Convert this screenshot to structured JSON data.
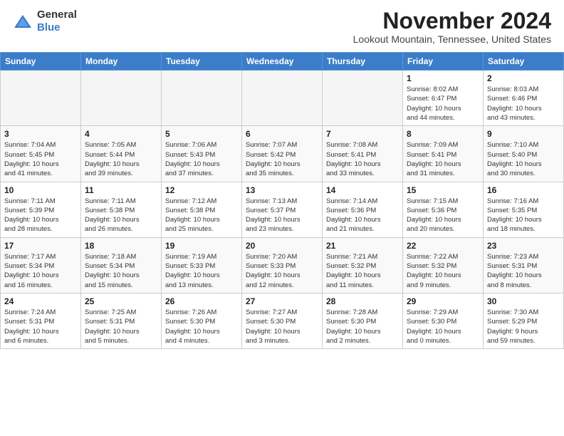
{
  "header": {
    "logo_general": "General",
    "logo_blue": "Blue",
    "month": "November 2024",
    "location": "Lookout Mountain, Tennessee, United States"
  },
  "weekdays": [
    "Sunday",
    "Monday",
    "Tuesday",
    "Wednesday",
    "Thursday",
    "Friday",
    "Saturday"
  ],
  "rows": [
    {
      "shaded": false,
      "cells": [
        {
          "empty": true
        },
        {
          "empty": true
        },
        {
          "empty": true
        },
        {
          "empty": true
        },
        {
          "empty": true
        },
        {
          "day": "1",
          "info": "Sunrise: 8:02 AM\nSunset: 6:47 PM\nDaylight: 10 hours\nand 44 minutes."
        },
        {
          "day": "2",
          "info": "Sunrise: 8:03 AM\nSunset: 6:46 PM\nDaylight: 10 hours\nand 43 minutes."
        }
      ]
    },
    {
      "shaded": true,
      "cells": [
        {
          "day": "3",
          "info": "Sunrise: 7:04 AM\nSunset: 5:45 PM\nDaylight: 10 hours\nand 41 minutes."
        },
        {
          "day": "4",
          "info": "Sunrise: 7:05 AM\nSunset: 5:44 PM\nDaylight: 10 hours\nand 39 minutes."
        },
        {
          "day": "5",
          "info": "Sunrise: 7:06 AM\nSunset: 5:43 PM\nDaylight: 10 hours\nand 37 minutes."
        },
        {
          "day": "6",
          "info": "Sunrise: 7:07 AM\nSunset: 5:42 PM\nDaylight: 10 hours\nand 35 minutes."
        },
        {
          "day": "7",
          "info": "Sunrise: 7:08 AM\nSunset: 5:41 PM\nDaylight: 10 hours\nand 33 minutes."
        },
        {
          "day": "8",
          "info": "Sunrise: 7:09 AM\nSunset: 5:41 PM\nDaylight: 10 hours\nand 31 minutes."
        },
        {
          "day": "9",
          "info": "Sunrise: 7:10 AM\nSunset: 5:40 PM\nDaylight: 10 hours\nand 30 minutes."
        }
      ]
    },
    {
      "shaded": false,
      "cells": [
        {
          "day": "10",
          "info": "Sunrise: 7:11 AM\nSunset: 5:39 PM\nDaylight: 10 hours\nand 28 minutes."
        },
        {
          "day": "11",
          "info": "Sunrise: 7:11 AM\nSunset: 5:38 PM\nDaylight: 10 hours\nand 26 minutes."
        },
        {
          "day": "12",
          "info": "Sunrise: 7:12 AM\nSunset: 5:38 PM\nDaylight: 10 hours\nand 25 minutes."
        },
        {
          "day": "13",
          "info": "Sunrise: 7:13 AM\nSunset: 5:37 PM\nDaylight: 10 hours\nand 23 minutes."
        },
        {
          "day": "14",
          "info": "Sunrise: 7:14 AM\nSunset: 5:36 PM\nDaylight: 10 hours\nand 21 minutes."
        },
        {
          "day": "15",
          "info": "Sunrise: 7:15 AM\nSunset: 5:36 PM\nDaylight: 10 hours\nand 20 minutes."
        },
        {
          "day": "16",
          "info": "Sunrise: 7:16 AM\nSunset: 5:35 PM\nDaylight: 10 hours\nand 18 minutes."
        }
      ]
    },
    {
      "shaded": true,
      "cells": [
        {
          "day": "17",
          "info": "Sunrise: 7:17 AM\nSunset: 5:34 PM\nDaylight: 10 hours\nand 16 minutes."
        },
        {
          "day": "18",
          "info": "Sunrise: 7:18 AM\nSunset: 5:34 PM\nDaylight: 10 hours\nand 15 minutes."
        },
        {
          "day": "19",
          "info": "Sunrise: 7:19 AM\nSunset: 5:33 PM\nDaylight: 10 hours\nand 13 minutes."
        },
        {
          "day": "20",
          "info": "Sunrise: 7:20 AM\nSunset: 5:33 PM\nDaylight: 10 hours\nand 12 minutes."
        },
        {
          "day": "21",
          "info": "Sunrise: 7:21 AM\nSunset: 5:32 PM\nDaylight: 10 hours\nand 11 minutes."
        },
        {
          "day": "22",
          "info": "Sunrise: 7:22 AM\nSunset: 5:32 PM\nDaylight: 10 hours\nand 9 minutes."
        },
        {
          "day": "23",
          "info": "Sunrise: 7:23 AM\nSunset: 5:31 PM\nDaylight: 10 hours\nand 8 minutes."
        }
      ]
    },
    {
      "shaded": false,
      "cells": [
        {
          "day": "24",
          "info": "Sunrise: 7:24 AM\nSunset: 5:31 PM\nDaylight: 10 hours\nand 6 minutes."
        },
        {
          "day": "25",
          "info": "Sunrise: 7:25 AM\nSunset: 5:31 PM\nDaylight: 10 hours\nand 5 minutes."
        },
        {
          "day": "26",
          "info": "Sunrise: 7:26 AM\nSunset: 5:30 PM\nDaylight: 10 hours\nand 4 minutes."
        },
        {
          "day": "27",
          "info": "Sunrise: 7:27 AM\nSunset: 5:30 PM\nDaylight: 10 hours\nand 3 minutes."
        },
        {
          "day": "28",
          "info": "Sunrise: 7:28 AM\nSunset: 5:30 PM\nDaylight: 10 hours\nand 2 minutes."
        },
        {
          "day": "29",
          "info": "Sunrise: 7:29 AM\nSunset: 5:30 PM\nDaylight: 10 hours\nand 0 minutes."
        },
        {
          "day": "30",
          "info": "Sunrise: 7:30 AM\nSunset: 5:29 PM\nDaylight: 9 hours\nand 59 minutes."
        }
      ]
    }
  ]
}
